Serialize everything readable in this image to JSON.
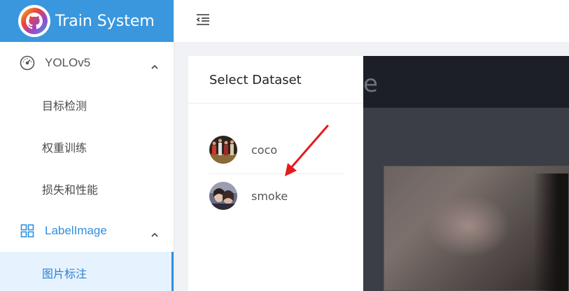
{
  "brand": {
    "title": "Train System",
    "icon": "github-octocat-logo"
  },
  "header": {
    "toggle_icon": "menu-fold-icon"
  },
  "sidebar": {
    "groups": [
      {
        "label": "YOLOv5",
        "icon": "dashboard-gauge-icon",
        "expanded": true,
        "items": [
          {
            "label": "目标检测",
            "active": false
          },
          {
            "label": "权重训练",
            "active": false
          },
          {
            "label": "损失和性能",
            "active": false
          }
        ]
      },
      {
        "label": "LabelImage",
        "icon": "grid-apps-icon",
        "expanded": true,
        "items": [
          {
            "label": "图片标注",
            "active": true
          }
        ]
      }
    ]
  },
  "dataset_panel": {
    "title": "Select Dataset",
    "datasets": [
      {
        "name": "coco"
      },
      {
        "name": "smoke"
      }
    ]
  },
  "preview": {
    "title_fragment": "e"
  },
  "colors": {
    "brand": "#3a97dd",
    "accent": "#2f8fe0",
    "active_bg": "#e6f3ff",
    "annotation_arrow": "#e8191e"
  }
}
